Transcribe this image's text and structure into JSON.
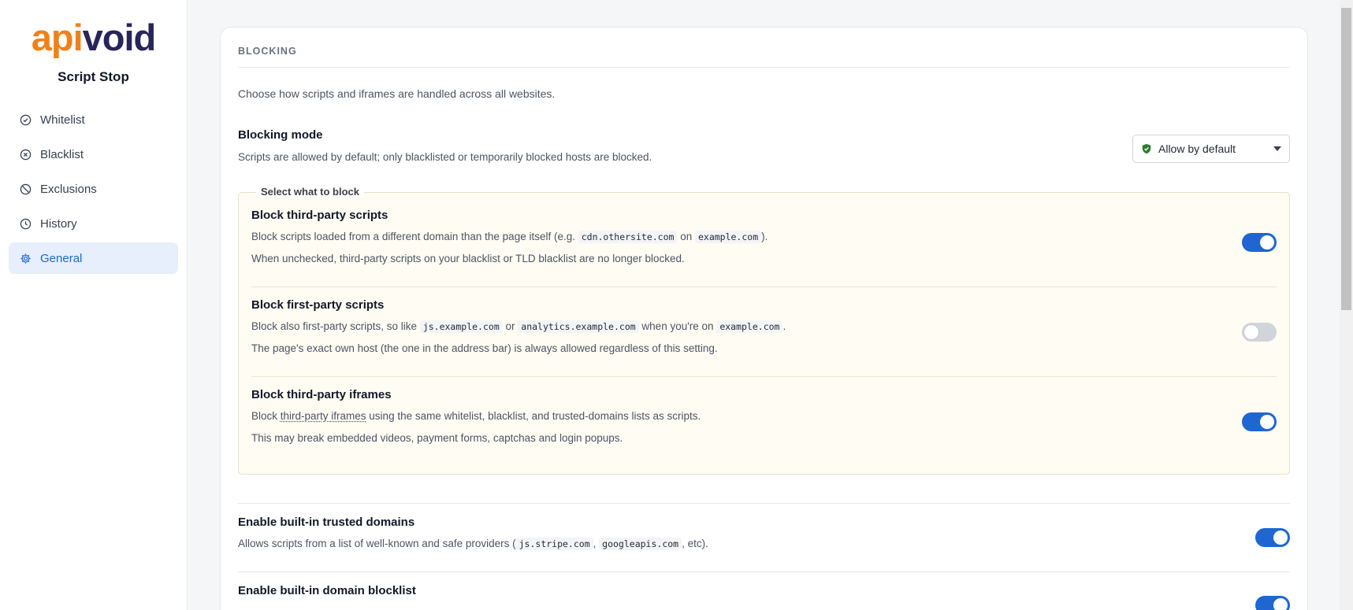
{
  "sidebar": {
    "logo_api": "api",
    "logo_void": "void",
    "app_name": "Script Stop",
    "items": [
      {
        "label": "Whitelist",
        "icon": "check-circle-icon"
      },
      {
        "label": "Blacklist",
        "icon": "x-circle-icon"
      },
      {
        "label": "Exclusions",
        "icon": "ban-icon"
      },
      {
        "label": "History",
        "icon": "clock-icon"
      },
      {
        "label": "General",
        "icon": "gear-icon",
        "active": true
      }
    ]
  },
  "blocking": {
    "section_title": "BLOCKING",
    "intro": "Choose how scripts and iframes are handled across all websites.",
    "mode_label": "Blocking mode",
    "mode_desc": "Scripts are allowed by default; only blacklisted or temporarily blocked hosts are blocked.",
    "mode_value": "Allow by default",
    "fieldset_legend": "Select what to block",
    "options": [
      {
        "label": "Block third-party scripts",
        "desc1_a": "Block scripts loaded from a different domain than the page itself (e.g. ",
        "code1": "cdn.othersite.com",
        "desc1_b": " on ",
        "code2": "example.com",
        "desc1_c": ").",
        "desc2": "When unchecked, third-party scripts on your blacklist or TLD blacklist are no longer blocked.",
        "enabled": true
      },
      {
        "label": "Block first-party scripts",
        "desc1_a": "Block also first-party scripts, so like ",
        "code1": "js.example.com",
        "desc1_b": " or ",
        "code2": "analytics.example.com",
        "desc1_c": " when you're on ",
        "code3": "example.com",
        "desc1_d": ".",
        "desc2": "The page's exact own host (the one in the address bar) is always allowed regardless of this setting.",
        "enabled": false
      },
      {
        "label": "Block third-party iframes",
        "desc1_a": "Block ",
        "underlined": "third-party iframes",
        "desc1_b": " using the same whitelist, blacklist, and trusted-domains lists as scripts.",
        "desc2": "This may break embedded videos, payment forms, captchas and login popups.",
        "enabled": true
      }
    ],
    "trusted": {
      "label": "Enable built-in trusted domains",
      "desc_a": "Allows scripts from a list of well-known and safe providers (",
      "code1": "js.stripe.com",
      "desc_b": ", ",
      "code2": "googleapis.com",
      "desc_c": ", etc).",
      "enabled": true
    },
    "blocklist": {
      "label": "Enable built-in domain blocklist",
      "enabled": true
    }
  },
  "colors": {
    "accent": "#1f66d1",
    "logo_orange": "#f0811a",
    "logo_navy": "#27255a",
    "panel_bg": "#fefcf3"
  }
}
